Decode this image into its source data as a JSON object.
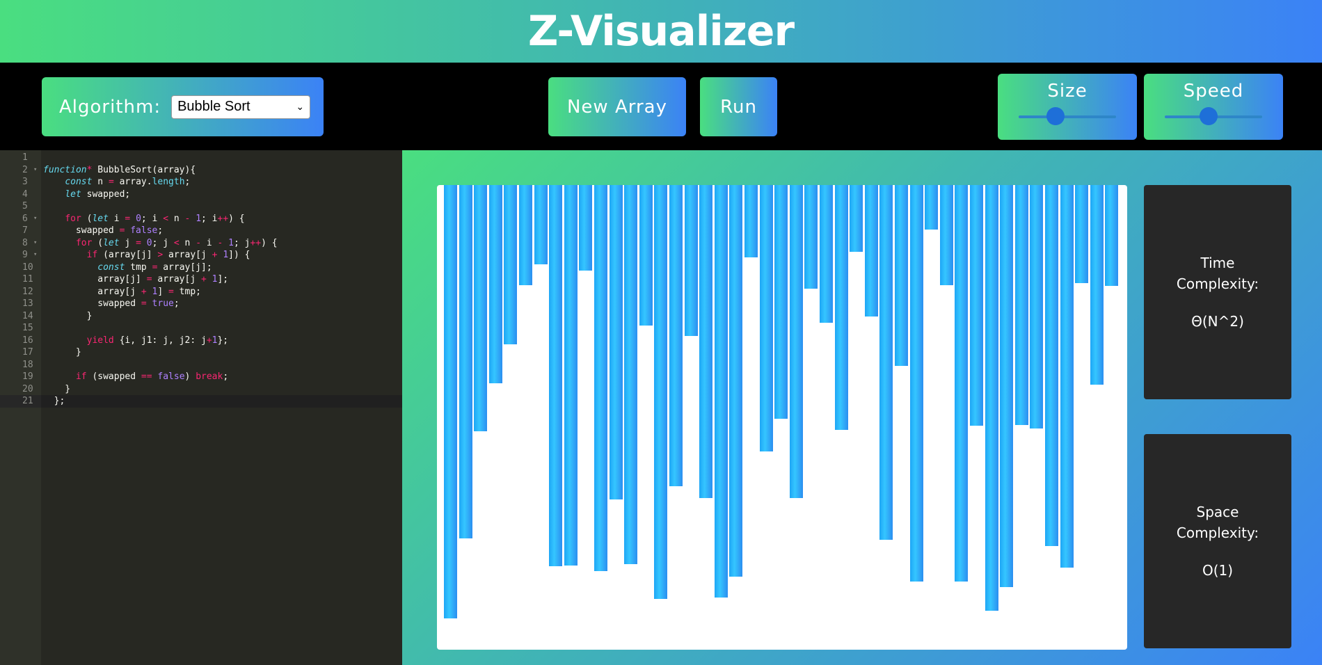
{
  "header": {
    "title": "Z-Visualizer"
  },
  "toolbar": {
    "algorithm_label": "Algorithm:",
    "algorithm_selected": "Bubble Sort",
    "new_array_label": "New Array",
    "run_label": "Run",
    "size_label": "Size",
    "speed_label": "Speed",
    "size_level": 0.38,
    "speed_level": 0.45
  },
  "editor": {
    "lines": [
      {
        "n": "1",
        "html": ""
      },
      {
        "n": "2",
        "fold": true,
        "html": "<span class=\"s\">function</span><span class=\"k\">*</span> BubbleSort(array){"
      },
      {
        "n": "3",
        "html": "    <span class=\"s\">const</span> n <span class=\"k\">=</span> array.<span class=\"p\">length</span>;"
      },
      {
        "n": "4",
        "html": "    <span class=\"s\">let</span> swapped;"
      },
      {
        "n": "5",
        "html": ""
      },
      {
        "n": "6",
        "fold": true,
        "html": "    <span class=\"k\">for</span> (<span class=\"s\">let</span> i <span class=\"k\">=</span> <span class=\"n\">0</span>; i <span class=\"k\">&lt;</span> n <span class=\"k\">-</span> <span class=\"n\">1</span>; i<span class=\"k\">++</span>) {"
      },
      {
        "n": "7",
        "html": "      swapped <span class=\"k\">=</span> <span class=\"n\">false</span>;"
      },
      {
        "n": "8",
        "fold": true,
        "html": "      <span class=\"k\">for</span> (<span class=\"s\">let</span> j <span class=\"k\">=</span> <span class=\"n\">0</span>; j <span class=\"k\">&lt;</span> n <span class=\"k\">-</span> i <span class=\"k\">-</span> <span class=\"n\">1</span>; j<span class=\"k\">++</span>) {"
      },
      {
        "n": "9",
        "fold": true,
        "html": "        <span class=\"k\">if</span> (array[j] <span class=\"k\">&gt;</span> array[j <span class=\"k\">+</span> <span class=\"n\">1</span>]) {"
      },
      {
        "n": "10",
        "html": "          <span class=\"s\">const</span> tmp <span class=\"k\">=</span> array[j];"
      },
      {
        "n": "11",
        "html": "          array[j] <span class=\"k\">=</span> array[j <span class=\"k\">+</span> <span class=\"n\">1</span>];"
      },
      {
        "n": "12",
        "html": "          array[j <span class=\"k\">+</span> <span class=\"n\">1</span>] <span class=\"k\">=</span> tmp;"
      },
      {
        "n": "13",
        "html": "          swapped <span class=\"k\">=</span> <span class=\"n\">true</span>;"
      },
      {
        "n": "14",
        "html": "        }"
      },
      {
        "n": "15",
        "html": ""
      },
      {
        "n": "16",
        "html": "        <span class=\"k\">yield</span> {i, j1: j, j2: j<span class=\"k\">+</span><span class=\"n\">1</span>};"
      },
      {
        "n": "17",
        "html": "      }"
      },
      {
        "n": "18",
        "html": ""
      },
      {
        "n": "19",
        "html": "      <span class=\"k\">if</span> (swapped <span class=\"k\">==</span> <span class=\"n\">false</span>) <span class=\"k\">break</span>;"
      },
      {
        "n": "20",
        "html": "    }"
      },
      {
        "n": "21",
        "active": true,
        "html": "  };"
      }
    ]
  },
  "chart_data": {
    "type": "bar",
    "values": [
      623,
      508,
      354,
      285,
      229,
      144,
      114,
      548,
      547,
      123,
      555,
      452,
      545,
      202,
      595,
      433,
      217,
      450,
      593,
      563,
      104,
      383,
      336,
      450,
      149,
      198,
      352,
      96,
      189,
      510,
      260,
      570,
      64,
      144,
      570,
      346,
      612,
      578,
      345,
      350,
      519,
      550,
      141,
      287,
      145
    ]
  },
  "complexity": {
    "time_title": "Time Complexity:",
    "time_value": "Θ(N^2)",
    "space_title": "Space Complexity:",
    "space_value": "O(1)"
  }
}
